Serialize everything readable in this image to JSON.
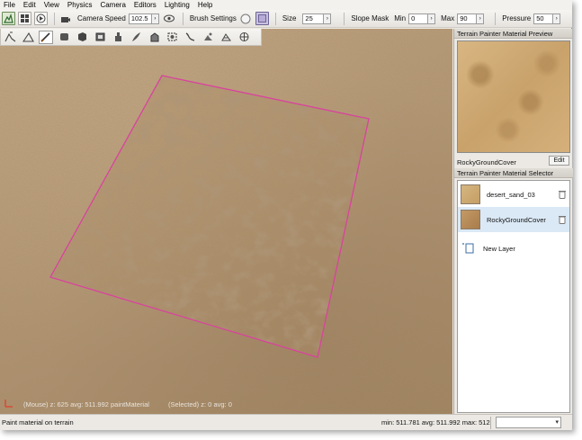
{
  "menu": [
    "File",
    "Edit",
    "View",
    "Physics",
    "Camera",
    "Editors",
    "Lighting",
    "Help"
  ],
  "toolbar": {
    "camera_speed_label": "Camera Speed",
    "camera_speed_value": "102.5",
    "brush_settings_label": "Brush Settings",
    "size_label": "Size",
    "size_value": "25",
    "slope_mask_label": "Slope Mask",
    "min_label": "Min",
    "min_value": "0",
    "max_label": "Max",
    "max_value": "90",
    "pressure_label": "Pressure",
    "pressure_value": "50",
    "arrow_glyph": "›"
  },
  "tools": [
    "terrain-raise-icon",
    "terrain-flatten-icon",
    "paint-brush-icon",
    "smooth-icon",
    "shape-icon",
    "mask-icon",
    "road-icon",
    "foliage-icon",
    "fill-icon",
    "select-area-icon",
    "river-icon",
    "object-icon",
    "mesh-icon",
    "globe-icon"
  ],
  "viewport": {
    "mouse_info": "(Mouse) z: 625  avg: 511.992  paintMaterial",
    "selected_info": "(Selected) z: 0  avg: 0",
    "selection_color": "#d9439e"
  },
  "material_preview": {
    "title": "Terrain Painter Material Preview",
    "name": "RockyGroundCover",
    "edit_label": "Edit"
  },
  "material_selector": {
    "title": "Terrain Painter Material Selector",
    "materials": [
      {
        "name": "desert_sand_03",
        "selected": false,
        "thumb": "#c9a572"
      },
      {
        "name": "RockyGroundCover",
        "selected": true,
        "thumb": "#b98e5d"
      }
    ],
    "new_layer_label": "New Layer"
  },
  "status": {
    "text": "Paint material on terrain",
    "stats": "min: 511.781  avg: 511.992  max: 512"
  }
}
